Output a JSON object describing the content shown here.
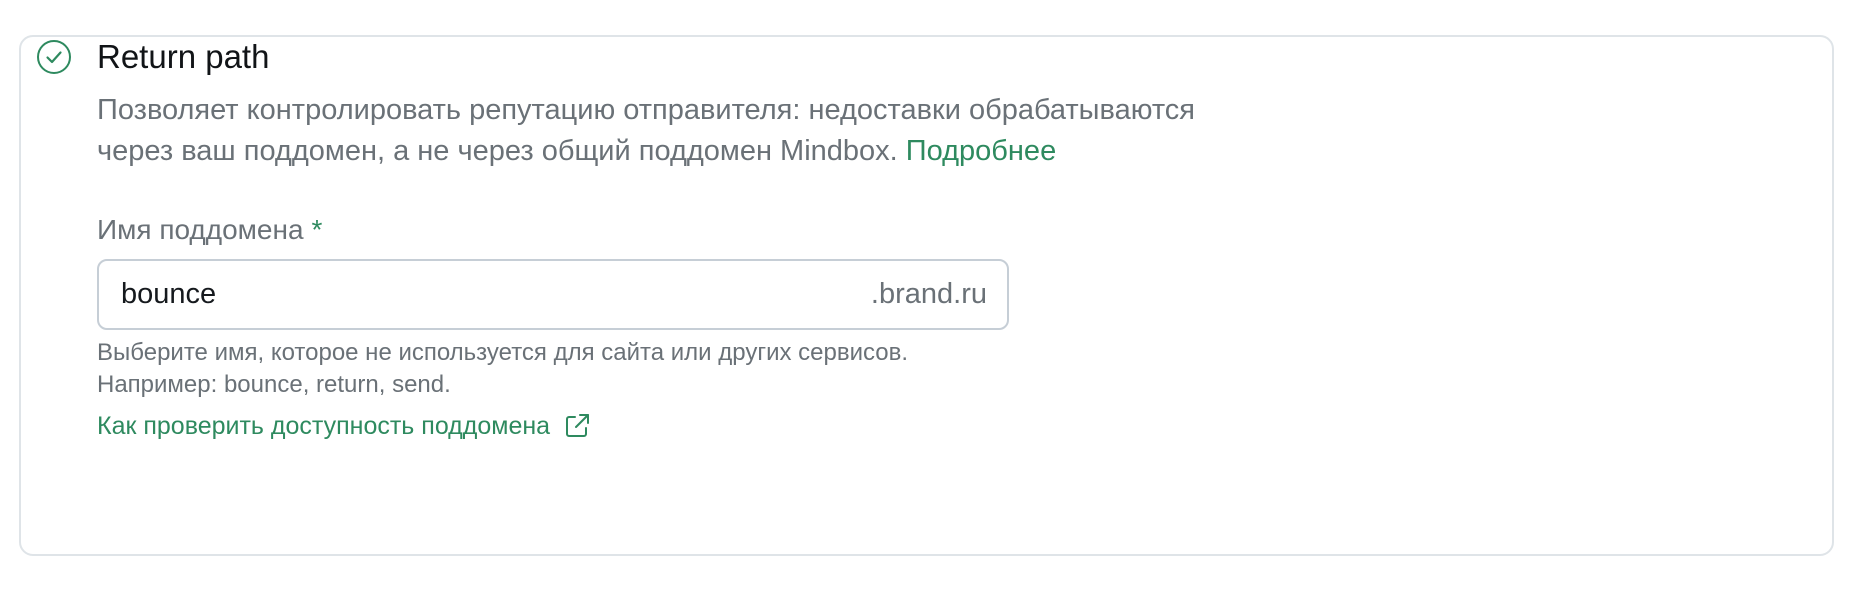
{
  "section": {
    "title": "Return path",
    "status_icon": "check-circle-icon",
    "description_line1": "Позволяет контролировать репутацию отправителя: недоставки обрабатываются",
    "description_line2": "через ваш поддомен, а не через общий поддомен Mindbox.",
    "more_link": "Подробнее"
  },
  "subdomain_field": {
    "label": "Имя поддомена",
    "required_mark": "*",
    "value": "bounce",
    "suffix": ".brand.ru",
    "hint_line1": "Выберите имя, которое не используется для сайта или других сервисов.",
    "hint_line2": "Например: bounce, return, send."
  },
  "check_availability_link": {
    "label": "Как проверить доступность поддомена",
    "icon": "external-link-icon"
  },
  "colors": {
    "accent": "#2e8a5f",
    "text_primary": "#111417",
    "text_secondary": "#6a7177",
    "border": "#dfe4e8",
    "input_border": "#c6ced6"
  }
}
